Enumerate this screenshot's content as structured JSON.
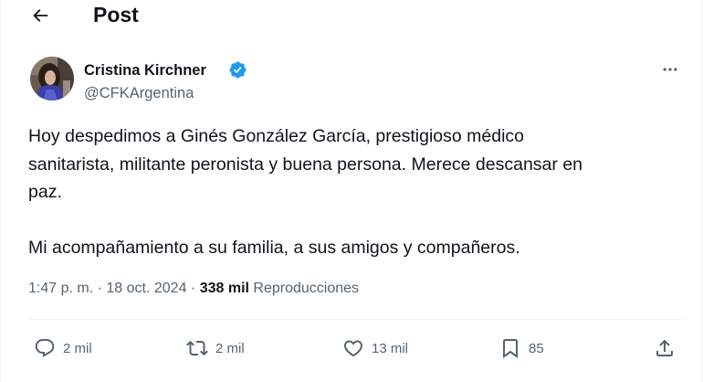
{
  "header": {
    "title": "Post"
  },
  "author": {
    "name": "Cristina Kirchner",
    "handle": "@CFKArgentina"
  },
  "tweet": {
    "text": "Hoy despedimos a Ginés González García, prestigioso médico\nsanitarista, militante peronista y buena persona. Merece descansar en\npaz.\n\nMi acompañamiento a su familia, a sus amigos y compañeros.",
    "time": "1:47 p. m.",
    "separator": "·",
    "date": "18 oct. 2024",
    "views_count": "338 mil",
    "views_label": "Reproducciones"
  },
  "actions": {
    "replies": "2 mil",
    "reposts": "2 mil",
    "likes": "13 mil",
    "bookmarks": "85"
  },
  "colors": {
    "text": "#0f1419",
    "secondary": "#536471",
    "verified": "#1d9bf0",
    "divider": "#eff3f4"
  },
  "icons": [
    "back-arrow-icon",
    "verified-badge-icon",
    "more-icon",
    "reply-icon",
    "repost-icon",
    "like-icon",
    "bookmark-icon",
    "share-icon"
  ]
}
